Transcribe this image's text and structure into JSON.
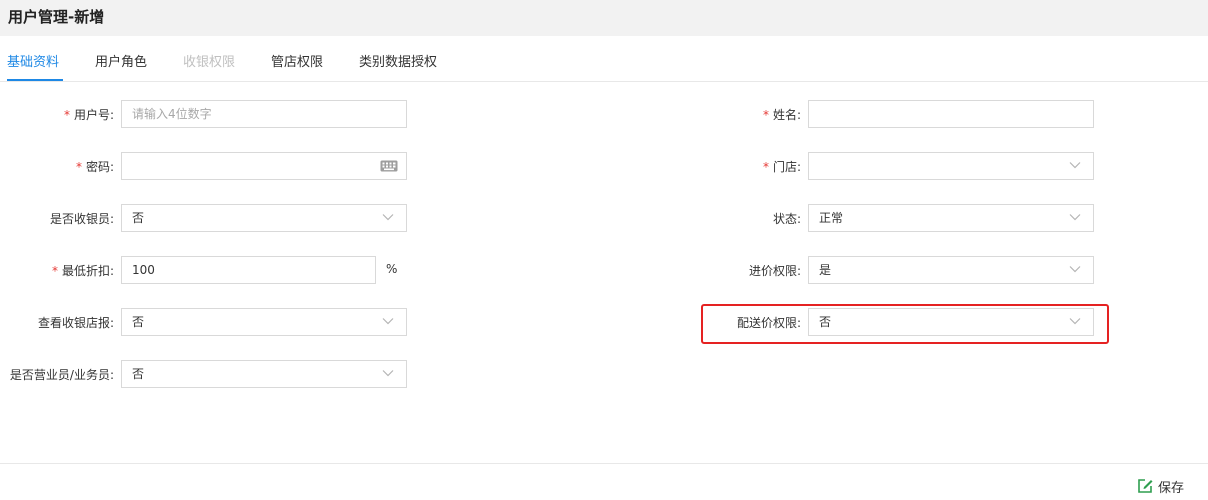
{
  "page": {
    "title": "用户管理-新增"
  },
  "tabs": [
    {
      "label": "基础资料",
      "state": "active"
    },
    {
      "label": "用户角色",
      "state": "normal"
    },
    {
      "label": "收银权限",
      "state": "disabled"
    },
    {
      "label": "管店权限",
      "state": "normal"
    },
    {
      "label": "类别数据授权",
      "state": "normal"
    }
  ],
  "form": {
    "user_no": {
      "label": "用户号:",
      "required": true,
      "value": "",
      "placeholder": "请输入4位数字"
    },
    "name": {
      "label": "姓名:",
      "required": true,
      "value": ""
    },
    "password": {
      "label": "密码:",
      "required": true,
      "value": "",
      "icon": "keyboard-icon"
    },
    "store": {
      "label": "门店:",
      "required": true,
      "value": ""
    },
    "is_cashier": {
      "label": "是否收银员:",
      "required": false,
      "value": "否"
    },
    "status": {
      "label": "状态:",
      "required": false,
      "value": "正常"
    },
    "min_discount": {
      "label": "最低折扣:",
      "required": true,
      "value": "100",
      "unit": "%"
    },
    "purchase_price_perm": {
      "label": "进价权限:",
      "required": false,
      "value": "是"
    },
    "view_cashier_report": {
      "label": "查看收银店报:",
      "required": false,
      "value": "否"
    },
    "delivery_price_perm": {
      "label": "配送价权限:",
      "required": false,
      "value": "否",
      "highlighted": true
    },
    "is_salesperson": {
      "label": "是否营业员/业务员:",
      "required": false,
      "value": "否"
    }
  },
  "footer": {
    "save_label": "保存",
    "save_icon": "edit-icon"
  },
  "colors": {
    "accent": "#1e88e5",
    "required": "#e53935",
    "highlight": "#e52222",
    "save_icon": "#2e9e4f"
  }
}
